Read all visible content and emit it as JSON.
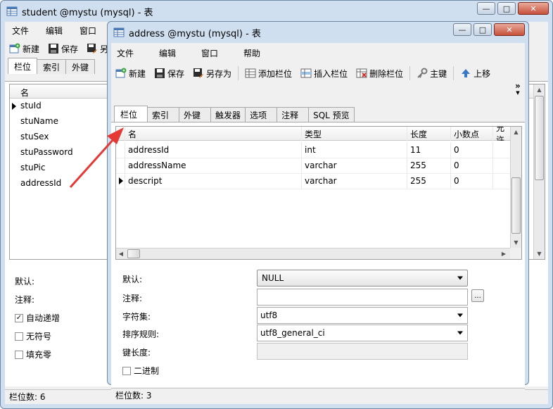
{
  "back_window": {
    "title": "student @mystu (mysql) - 表",
    "menu": [
      "文件",
      "编辑",
      "窗口"
    ],
    "toolbar": {
      "new": "新建",
      "save": "保存",
      "saveas": "另"
    },
    "tabs": [
      "栏位",
      "索引",
      "外键"
    ],
    "grid_header": "名",
    "fields": [
      "stuId",
      "stuName",
      "stuSex",
      "stuPassword",
      "stuPic",
      "addressId"
    ],
    "default_label": "默认:",
    "comment_label": "注释:",
    "checks": [
      {
        "label": "自动递增",
        "checked": true
      },
      {
        "label": "无符号",
        "checked": false
      },
      {
        "label": "填充零",
        "checked": false
      }
    ],
    "status": "栏位数: 6"
  },
  "front_window": {
    "title": "address @mystu (mysql) - 表",
    "menu": [
      "文件",
      "编辑",
      "窗口",
      "帮助"
    ],
    "toolbar": {
      "new": "新建",
      "save": "保存",
      "saveas": "另存为",
      "add_field": "添加栏位",
      "insert_field": "插入栏位",
      "delete_field": "删除栏位",
      "primary_key": "主键",
      "move_up": "上移",
      "more": "»"
    },
    "tabs": [
      "栏位",
      "索引",
      "外键",
      "触发器",
      "选项",
      "注释",
      "SQL 预览"
    ],
    "columns": [
      "名",
      "类型",
      "长度",
      "小数点",
      "允许"
    ],
    "rows": [
      {
        "name": "addressId",
        "type": "int",
        "length": "11",
        "decimals": "0"
      },
      {
        "name": "addressName",
        "type": "varchar",
        "length": "255",
        "decimals": "0"
      },
      {
        "name": "descript",
        "type": "varchar",
        "length": "255",
        "decimals": "0"
      }
    ],
    "props": {
      "default_label": "默认:",
      "default_value": "NULL",
      "comment_label": "注释:",
      "comment_value": "",
      "comment_btn": "...",
      "charset_label": "字符集:",
      "charset_value": "utf8",
      "collation_label": "排序规则:",
      "collation_value": "utf8_general_ci",
      "keylen_label": "键长度:",
      "keylen_value": "",
      "binary_label": "二进制"
    },
    "status": "栏位数: 3"
  },
  "colors": {
    "frame": "#cfdfef",
    "arrow": "#e53935",
    "close": "#c7503a"
  }
}
